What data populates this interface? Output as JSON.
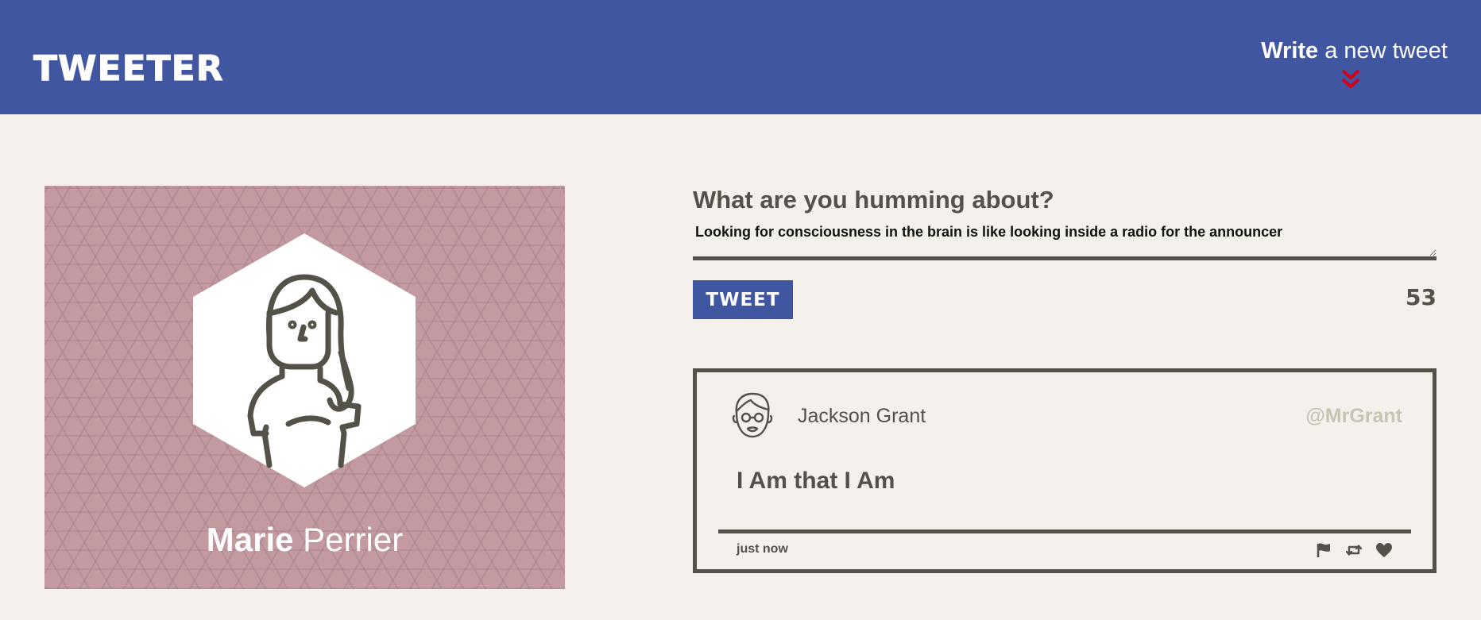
{
  "app": {
    "logo": "TWEETER"
  },
  "header": {
    "compose_toggle_bold": "Write",
    "compose_toggle_rest": " a new tweet",
    "chevron_color": "#d0021b"
  },
  "profile": {
    "first_name": "Marie",
    "last_name": " Perrier",
    "background_color": "#c29aa0"
  },
  "compose": {
    "title": "What are you humming about?",
    "text_value": "Looking for consciousness in the brain is like looking inside a radio for the announcer",
    "button_label": "TWEET",
    "char_counter": "53"
  },
  "tweet": {
    "name": "Jackson Grant",
    "handle": "@MrGrant",
    "content": "I Am that I Am",
    "timestamp": "just now",
    "actions": [
      "flag-icon",
      "retweet-icon",
      "heart-icon"
    ]
  },
  "colors": {
    "header_bg": "#4056a1",
    "page_bg": "#f4f1ed",
    "text": "#545149",
    "handle": "#c8c3b2"
  }
}
